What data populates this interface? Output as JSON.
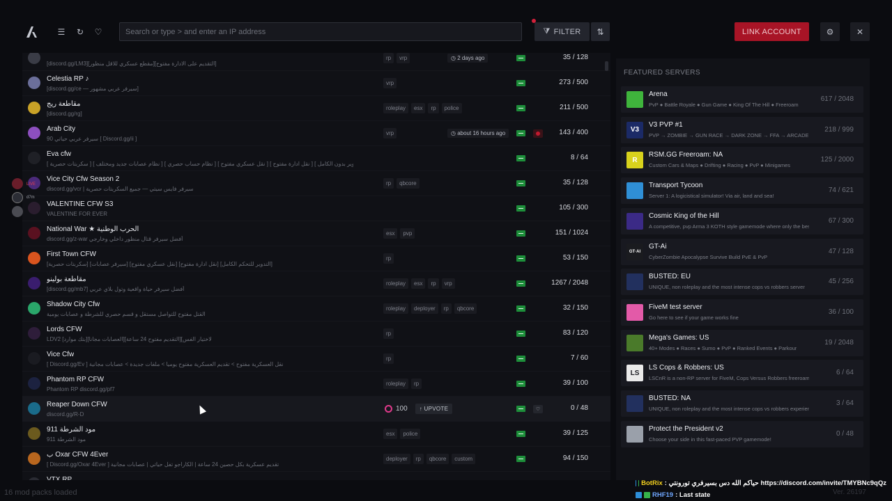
{
  "search": {
    "placeholder": "Search or type > and enter an IP address"
  },
  "toolbar": {
    "filter_label": "FILTER",
    "link_account_label": "LINK ACCOUNT"
  },
  "servers": [
    {
      "name": "",
      "desc": "[discord.gg/LM3][مقطع عسكري للاقل منظور][التقديم على الادارة مفتوح]",
      "tags": [
        "rp",
        "vrp"
      ],
      "players": "35 / 128",
      "updated": "2 days ago",
      "icon_color": "#3a3c46"
    },
    {
      "name": "Celestia RP ♪",
      "desc": "[discord.gg/ce — سيرفر عربي مشهور]",
      "tags": [
        "vrp"
      ],
      "players": "273 / 500",
      "icon_color": "#6b6f9a"
    },
    {
      "name": "مقاطعة ريج",
      "desc": "[discord.gg/rg]",
      "tags": [
        "roleplay",
        "esx",
        "rp",
        "police"
      ],
      "players": "211 / 500",
      "icon_color": "#c9a227"
    },
    {
      "name": "Arab City",
      "desc": "90 سيرفر عربي حياتي [ Discord.gg/ii ]",
      "tags": [
        "vrp"
      ],
      "players": "143 / 400",
      "updated": "about 16 hours ago",
      "icon_color": "#8d4fbf"
    },
    {
      "name": "Eva cfw",
      "desc": "[ سكربتات حصرية ] [ نظام عصابات جديد ومختلف ] [ نظام حساب حصري ] [ نقل عسكري مفتوح ] [ نقل ادارة مفتوح ] [ التدوير بدون الكامل ]",
      "tags": [],
      "players": "8 / 64",
      "icon_color": "#1f2026"
    },
    {
      "name": "Vice City Cfw Season 2",
      "desc": "discord.gg/vcr | سيرفر فايس سيتي — جميع السكربتات حصرية",
      "tags": [
        "rp",
        "qbcore"
      ],
      "players": "35 / 128",
      "icon_color": "#4b2a7a"
    },
    {
      "name": "VALENTINE CFW S3",
      "desc": "VALENTINE FOR EVER",
      "tags": [],
      "players": "105 / 300",
      "icon_color": "#2a1d2e"
    },
    {
      "name": "National War ★ الحرب الوطنية",
      "desc": "discord.gg/z-war أفضل سيرفر قتال منظور داخلي وخارجي",
      "tags": [
        "esx",
        "pvp"
      ],
      "players": "151 / 1024",
      "icon_color": "#5a1120"
    },
    {
      "name": "First Town CFW",
      "desc": "[سكربتات حصرية] [سيرفر عصابات] [نقل عسكري مفتوح] [نقل ادارة مفتوح] [التدوير للتحكم الكامل]",
      "tags": [
        "rp"
      ],
      "players": "53 / 150",
      "icon_color": "#d9541e"
    },
    {
      "name": "مقاطعة بولينو",
      "desc": "[discord.gg/mb7] أفضل سيرفر حياة واقعية وتول بلاي عربي",
      "tags": [
        "roleplay",
        "esx",
        "rp",
        "vrp"
      ],
      "players": "1267 / 2048",
      "icon_color": "#3a1d6e"
    },
    {
      "name": "Shadow City Cfw",
      "desc": "القتل مفتوح للتواصل مستقل و قسم حصري للشرطة و عصابات يومية",
      "tags": [
        "roleplay",
        "deployer",
        "rp",
        "qbcore"
      ],
      "players": "32 / 150",
      "icon_color": "#2aa66a"
    },
    {
      "name": "Lords CFW",
      "desc": "LDV2 لاختيار الفس][التقديم مفتوح 24 ساعة][العصابات مجانا][بتك موارد]",
      "tags": [
        "rp"
      ],
      "players": "83 / 120",
      "icon_color": "#2e1d3a"
    },
    {
      "name": "Vice Cfw",
      "desc": "[ Discord.gg/Ev ] نقل العسكرية مفتوح > تقديم العسكرية مفتوح يوميا > ملفات جديدة > عصابات مجانية",
      "tags": [
        "rp"
      ],
      "players": "7 / 60",
      "icon_color": "#1a1b21"
    },
    {
      "name": "Phantom RP CFW",
      "desc": "Phantom RP discord.gg/pf7",
      "tags": [
        "roleplay",
        "rp"
      ],
      "players": "39 / 100",
      "icon_color": "#1c2240"
    },
    {
      "name": "Reaper Down CFW",
      "desc": "discord.gg/R-D",
      "tags": [],
      "players": "0 / 48",
      "upvotes": "100",
      "upvote_label": "UPVOTE",
      "icon_color": "#1a6b8a"
    },
    {
      "name": "مود الشرطة 911",
      "desc": "مود الشرطة 911",
      "tags": [
        "esx",
        "police"
      ],
      "players": "39 / 125",
      "icon_color": "#6b5a1e"
    },
    {
      "name": "ب Oxar CFW 4Ever",
      "desc": "[ Discord.gg/Oxar 4Ever ] تقديم عسكرية بكل حصين 24 ساعة | الكاراجو تفل حياتي | عصابات مجانية",
      "tags": [
        "deployer",
        "rp",
        "qbcore",
        "custom"
      ],
      "players": "94 / 150",
      "icon_color": "#b8661e"
    },
    {
      "name": "VTX RP ...",
      "desc": "",
      "tags": [],
      "players": "",
      "icon_color": "#2a2b33"
    }
  ],
  "featured": {
    "title": "FEATURED SERVERS",
    "items": [
      {
        "name": "Arena",
        "desc": "PvP ● Battle Royale ● Gun Game ● King Of The Hill ● Freeroam",
        "players": "617 / 2048",
        "icon_text": "",
        "icon_color": "#3fb43c"
      },
      {
        "name": "V3 PVP #1",
        "desc": "PVP → ZOMBIE → GUN RACE → DARK ZONE → FFA → ARCADE",
        "players": "218 / 999",
        "icon_text": "V3",
        "icon_color": "#1b2a66"
      },
      {
        "name": "RSM.GG Freeroam: NA",
        "desc": "Custom Cars & Maps ● Drifting ● Racing ● PvP ● Minigames",
        "players": "125 / 2000",
        "icon_text": "R",
        "icon_color": "#d8d21c"
      },
      {
        "name": "Transport Tycoon",
        "desc": "Server 1: A logicistical simulator! Via air, land and sea!",
        "players": "74 / 621",
        "icon_text": "",
        "icon_color": "#2f8fd6"
      },
      {
        "name": "Cosmic King of the Hill",
        "desc": "A competitive, pvp Arma 3 KOTH style gamemode where only the best",
        "players": "67 / 300",
        "icon_text": "",
        "icon_color": "#3b2a86"
      },
      {
        "name": "GT-Ai",
        "desc": "CyberZombie Apocalypse Survive Build PvE & PvP",
        "players": "47 / 128",
        "icon_text": "GT·AI",
        "icon_color": "#1a1b1f"
      },
      {
        "name": "BUSTED: EU",
        "desc": "UNIQUE, non roleplay and the most intense cops vs robbers server",
        "players": "45 / 256",
        "icon_text": "",
        "icon_color": "#22305e"
      },
      {
        "name": "FiveM test server",
        "desc": "Go here to see if your game works fine",
        "players": "36 / 100",
        "icon_text": "",
        "icon_color": "#e35aa8"
      },
      {
        "name": "Mega's Games: US",
        "desc": "40+ Modes ● Races ● Sumo ● PvP ● Ranked Events ● Parkour",
        "players": "19 / 2048",
        "icon_text": "",
        "icon_color": "#4a7a2a"
      },
      {
        "name": "LS Cops & Robbers: US",
        "desc": "LSCnR is a non-RP server for FiveM, Cops Versus Robbers freeroam",
        "players": "6 / 64",
        "icon_text": "LS",
        "icon_color": "#eaeaea"
      },
      {
        "name": "BUSTED: NA",
        "desc": "UNIQUE, non roleplay and the most intense cops vs robbers experience",
        "players": "3 / 64",
        "icon_text": "",
        "icon_color": "#22305e"
      },
      {
        "name": "Protect the President v2",
        "desc": "Choose your side in this fast-paced PVP gamemode!",
        "players": "0 / 48",
        "icon_text": "",
        "icon_color": "#9aa0aa"
      }
    ]
  },
  "side_overlay": {
    "label_1": "d7m",
    "label_2": "LIVE"
  },
  "status": {
    "modpacks": "16 mod packs loaded",
    "version": "Ver. 26197"
  },
  "chat": [
    {
      "user": "BotRix",
      "message": ": حياكم الله دس بسيرفري تورونتي https://discord.com/invite/TMYBNc9qQz"
    },
    {
      "user": "RHF19",
      "message": ": Last state"
    }
  ],
  "colors": {
    "accent": "#a81426",
    "flag_green": "#1d8e3a",
    "background": "#0b0c10"
  }
}
